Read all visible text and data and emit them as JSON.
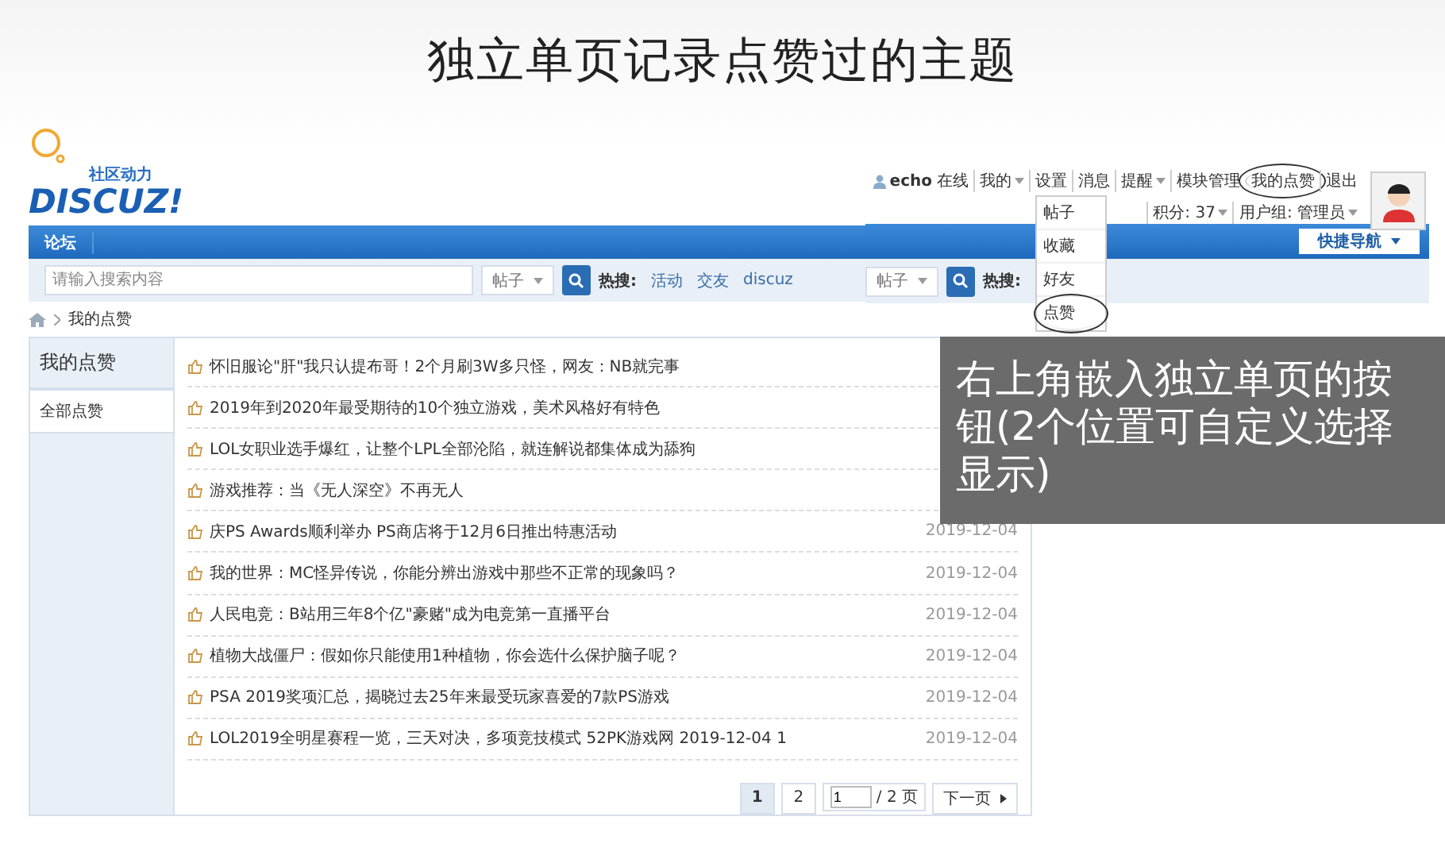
{
  "slide_title": "独立单页记录点赞过的主题",
  "site": {
    "logo_tagline": "社区动力",
    "logo": "DISCUZ!",
    "nav": [
      {
        "label": "论坛",
        "selected": true
      }
    ],
    "search": {
      "placeholder": "请输入搜索内容",
      "scope": "帖子"
    },
    "hot_search": {
      "label": "热搜:",
      "links": [
        "活动",
        "交友",
        "discuz"
      ]
    },
    "breadcrumb": [
      "我的点赞"
    ],
    "sidebar": {
      "title": "我的点赞",
      "items": [
        {
          "label": "全部点赞",
          "selected": true
        }
      ]
    },
    "threads": [
      {
        "title": "怀旧服论\"肝\"我只认提布哥！2个月刷3W多只怪，网友：NB就完事"
      },
      {
        "title": "2019年到2020年最受期待的10个独立游戏，美术风格好有特色"
      },
      {
        "title": "LOL女职业选手爆红，让整个LPL全部沦陷，就连解说都集体成为舔狗"
      },
      {
        "title": "游戏推荐：当《无人深空》不再无人"
      },
      {
        "title": "庆PS Awards顺利举办 PS商店将于12月6日推出特惠活动",
        "date": "2019-12-04"
      },
      {
        "title": "我的世界：MC怪异传说，你能分辨出游戏中那些不正常的现象吗？",
        "date": "2019-12-04"
      },
      {
        "title": "人民电竞：B站用三年8个亿\"豪赌\"成为电竞第一直播平台",
        "date": "2019-12-04"
      },
      {
        "title": "植物大战僵尸：假如你只能使用1种植物，你会选什么保护脑子呢？",
        "date": "2019-12-04"
      },
      {
        "title": "PSA 2019奖项汇总，揭晓过去25年来最受玩家喜爱的7款PS游戏",
        "date": "2019-12-04"
      },
      {
        "title": "LOL2019全明星赛程一览，三天对决，多项竞技模式 52PK游戏网 2019-12-04 1",
        "date": "2019-12-04"
      }
    ],
    "pager": {
      "pages": [
        {
          "label": "1",
          "selected": true
        },
        {
          "label": "2",
          "selected": false
        }
      ],
      "page_input": "1",
      "total": "/ 2 页",
      "next": "下一页"
    }
  },
  "header_inset": {
    "user": "echo",
    "status": "在线",
    "links": [
      {
        "label": "我的",
        "dropdown": true,
        "circled": false
      },
      {
        "label": "设置",
        "dropdown": false,
        "circled": false
      },
      {
        "label": "消息",
        "dropdown": false,
        "circled": false
      },
      {
        "label": "提醒",
        "dropdown": true,
        "circled": false
      },
      {
        "label": "模块管理",
        "dropdown": false,
        "circled": false
      },
      {
        "label": "我的点赞",
        "dropdown": false,
        "circled": true
      },
      {
        "label": "退出",
        "dropdown": false,
        "circled": false
      }
    ],
    "credits": "积分: 37",
    "group": "用户组: 管理员",
    "menu": [
      {
        "label": "帖子",
        "circled": false
      },
      {
        "label": "收藏",
        "circled": false
      },
      {
        "label": "好友",
        "circled": false
      },
      {
        "label": "点赞",
        "circled": true
      }
    ],
    "quick_nav": "快捷导航",
    "search_scope": "帖子",
    "hot_label": "热搜:"
  },
  "callout": "右上角嵌入独立单页的按钮(2个位置可自定义选择显示)"
}
